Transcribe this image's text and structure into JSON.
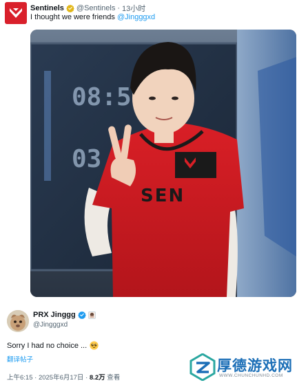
{
  "tweet": {
    "author_name": "Sentinels",
    "handle": "@Sentinels",
    "separator": "·",
    "time": "13小时",
    "text_prefix": "I thought we were friends ",
    "mention": "@Jingggxd",
    "photo": {
      "jersey_text": "SEN"
    }
  },
  "reply": {
    "author_name": "PRX Jinggg",
    "handle": "@Jingggxd",
    "text": "Sorry I had no choice ...",
    "emoji": "🥺",
    "translate": "翻译帖子",
    "time": "上午6:15",
    "dot1": "·",
    "date": "2025年6月17日",
    "dot2": "·",
    "views": "8.2万",
    "views_label": "查看"
  },
  "watermark": {
    "name": "厚德游戏网",
    "url": "WWW.CHUNCHUNHD.COM"
  },
  "colors": {
    "sentinels_red": "#d9202b",
    "link_blue": "#1d9bf0",
    "verified_gold": "#e2b719",
    "verified_blue": "#1d9bf0",
    "watermark_blue": "#1c6fb7",
    "watermark_teal": "#2aa7a0"
  },
  "icons": [
    "sentinels-logo-icon",
    "verified-gold-icon",
    "verified-blue-icon",
    "affiliate-badge-icon",
    "pleading-face-emoji",
    "watermark-logo-icon"
  ]
}
